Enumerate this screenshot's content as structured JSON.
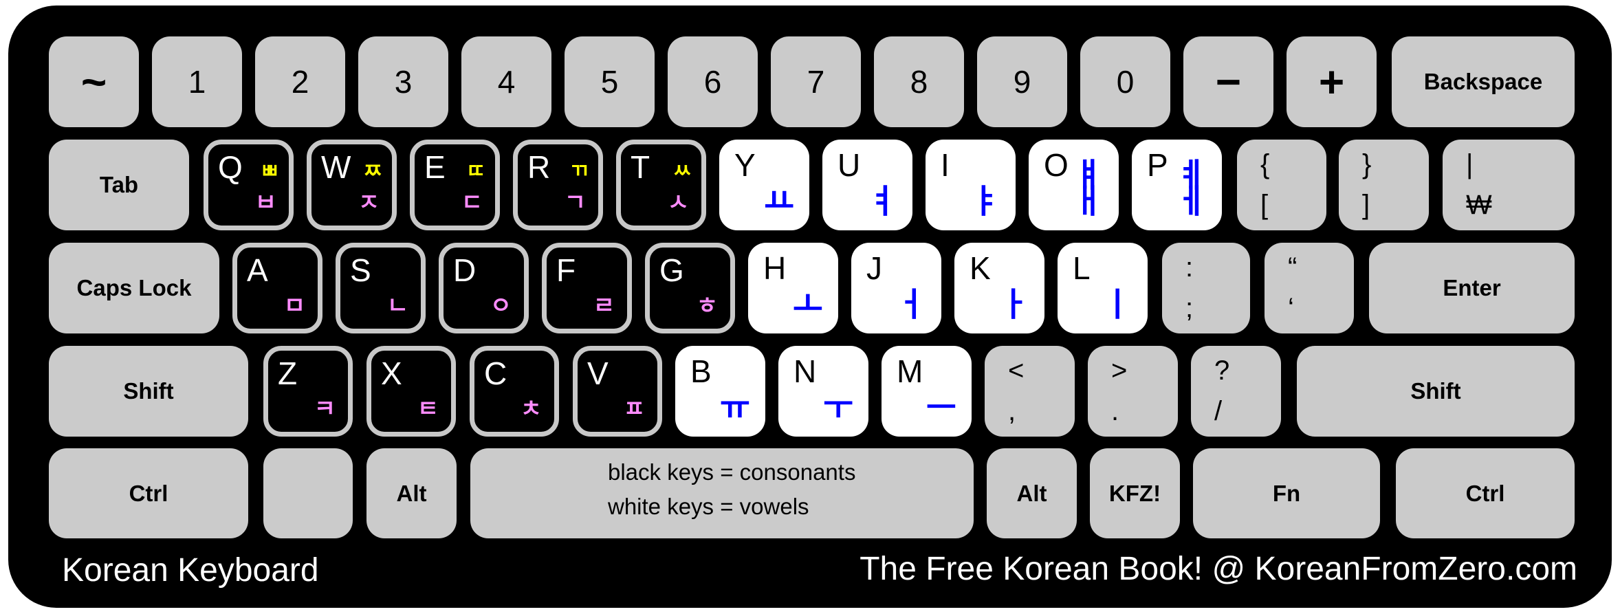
{
  "footer": {
    "title": "Korean Keyboard",
    "credit": "The Free Korean Book! @  KoreanFromZero.com"
  },
  "legend": {
    "line1": "black keys = consonants",
    "line2": "white keys = vowels"
  },
  "colors": {
    "body": "#000000",
    "key_gray": "#cbcbcb",
    "consonant_outline": "#c8c8c8",
    "double_consonant": "#ffff00",
    "consonant": "#ff8cff",
    "vowel": "#0000ff"
  },
  "row1": {
    "tilde": "~",
    "n1": "1",
    "n2": "2",
    "n3": "3",
    "n4": "4",
    "n5": "5",
    "n6": "6",
    "n7": "7",
    "n8": "8",
    "n9": "9",
    "n0": "0",
    "minus": "−",
    "plus": "+",
    "backspace": "Backspace"
  },
  "row2": {
    "tab": "Tab",
    "q": {
      "latin": "Q",
      "double": "ㅃ",
      "base": "ㅂ"
    },
    "w": {
      "latin": "W",
      "double": "ㅉ",
      "base": "ㅈ"
    },
    "e": {
      "latin": "E",
      "double": "ㄸ",
      "base": "ㄷ"
    },
    "r": {
      "latin": "R",
      "double": "ㄲ",
      "base": "ㄱ"
    },
    "t": {
      "latin": "T",
      "double": "ㅆ",
      "base": "ㅅ"
    },
    "y": {
      "latin": "Y",
      "vowel": "ㅛ"
    },
    "u": {
      "latin": "U",
      "vowel": "ㅕ"
    },
    "i": {
      "latin": "I",
      "vowel": "ㅑ"
    },
    "o": {
      "latin": "O",
      "vowel_top": "ㅒ",
      "vowel": "ㅐ"
    },
    "p": {
      "latin": "P",
      "vowel_top": "ㅖ",
      "vowel": "ㅔ"
    },
    "lbrace": {
      "top": "{",
      "bottom": "["
    },
    "rbrace": {
      "top": "}",
      "bottom": "]"
    },
    "pipe": {
      "top": "|",
      "bottom": "₩"
    }
  },
  "row3": {
    "caps": "Caps Lock",
    "a": {
      "latin": "A",
      "base": "ㅁ"
    },
    "s": {
      "latin": "S",
      "base": "ㄴ"
    },
    "d": {
      "latin": "D",
      "base": "ㅇ"
    },
    "f": {
      "latin": "F",
      "base": "ㄹ"
    },
    "g": {
      "latin": "G",
      "base": "ㅎ"
    },
    "h": {
      "latin": "H",
      "vowel": "ㅗ"
    },
    "j": {
      "latin": "J",
      "vowel": "ㅓ"
    },
    "k": {
      "latin": "K",
      "vowel": "ㅏ"
    },
    "l": {
      "latin": "L",
      "vowel": "ㅣ"
    },
    "semi": {
      "top": ":",
      "bottom": ";"
    },
    "quote": {
      "top": "“",
      "bottom": "‘"
    },
    "enter": "Enter"
  },
  "row4": {
    "shift_left": "Shift",
    "z": {
      "latin": "Z",
      "base": "ㅋ"
    },
    "x": {
      "latin": "X",
      "base": "ㅌ"
    },
    "c": {
      "latin": "C",
      "base": "ㅊ"
    },
    "v": {
      "latin": "V",
      "base": "ㅍ"
    },
    "b": {
      "latin": "B",
      "vowel": "ㅠ"
    },
    "n": {
      "latin": "N",
      "vowel": "ㅜ"
    },
    "m": {
      "latin": "M",
      "vowel": "ㅡ"
    },
    "comma": {
      "top": "<",
      "bottom": ","
    },
    "period": {
      "top": ">",
      "bottom": "."
    },
    "slash": {
      "top": "?",
      "bottom": "/"
    },
    "shift_right": "Shift"
  },
  "row5": {
    "ctrl_left": "Ctrl",
    "blank": "",
    "alt_left": "Alt",
    "alt_right": "Alt",
    "kfz": "KFZ!",
    "fn": "Fn",
    "ctrl_right": "Ctrl"
  }
}
